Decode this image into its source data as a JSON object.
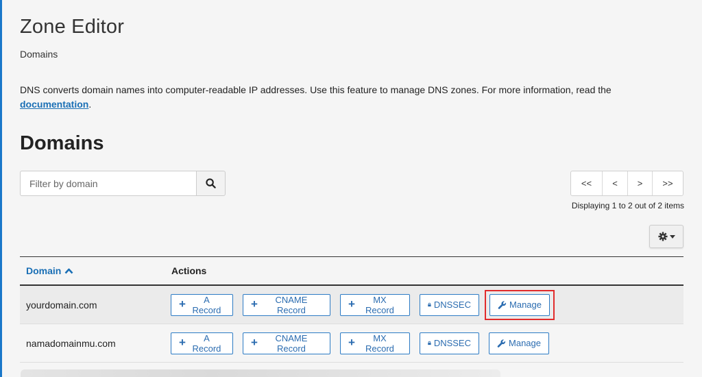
{
  "page": {
    "title": "Zone Editor",
    "breadcrumb": "Domains",
    "description": "DNS converts domain names into computer-readable IP addresses. Use this feature to manage DNS zones. For more information, read the",
    "doc_link": "documentation",
    "doc_suffix": "."
  },
  "section": {
    "title": "Domains"
  },
  "search": {
    "placeholder": "Filter by domain",
    "icon": "search-icon"
  },
  "pagination": {
    "first": "<<",
    "prev": "<",
    "next": ">",
    "last": ">>",
    "status": "Displaying 1 to 2 out of 2 items"
  },
  "settings": {
    "icon": "gear-icon"
  },
  "table": {
    "headers": {
      "domain": "Domain",
      "actions": "Actions"
    },
    "sort": "ascending",
    "rows": [
      {
        "domain": "yourdomain.com",
        "a_record": "A Record",
        "cname_record": "CNAME Record",
        "mx_record": "MX Record",
        "dnssec": "DNSSEC",
        "manage": "Manage"
      },
      {
        "domain": "namadomainmu.com",
        "a_record": "A Record",
        "cname_record": "CNAME Record",
        "mx_record": "MX Record",
        "dnssec": "DNSSEC",
        "manage": "Manage"
      }
    ]
  },
  "colors": {
    "accent": "#1a6fb5",
    "highlight": "#e12b2b",
    "background": "#f5f5f5"
  }
}
